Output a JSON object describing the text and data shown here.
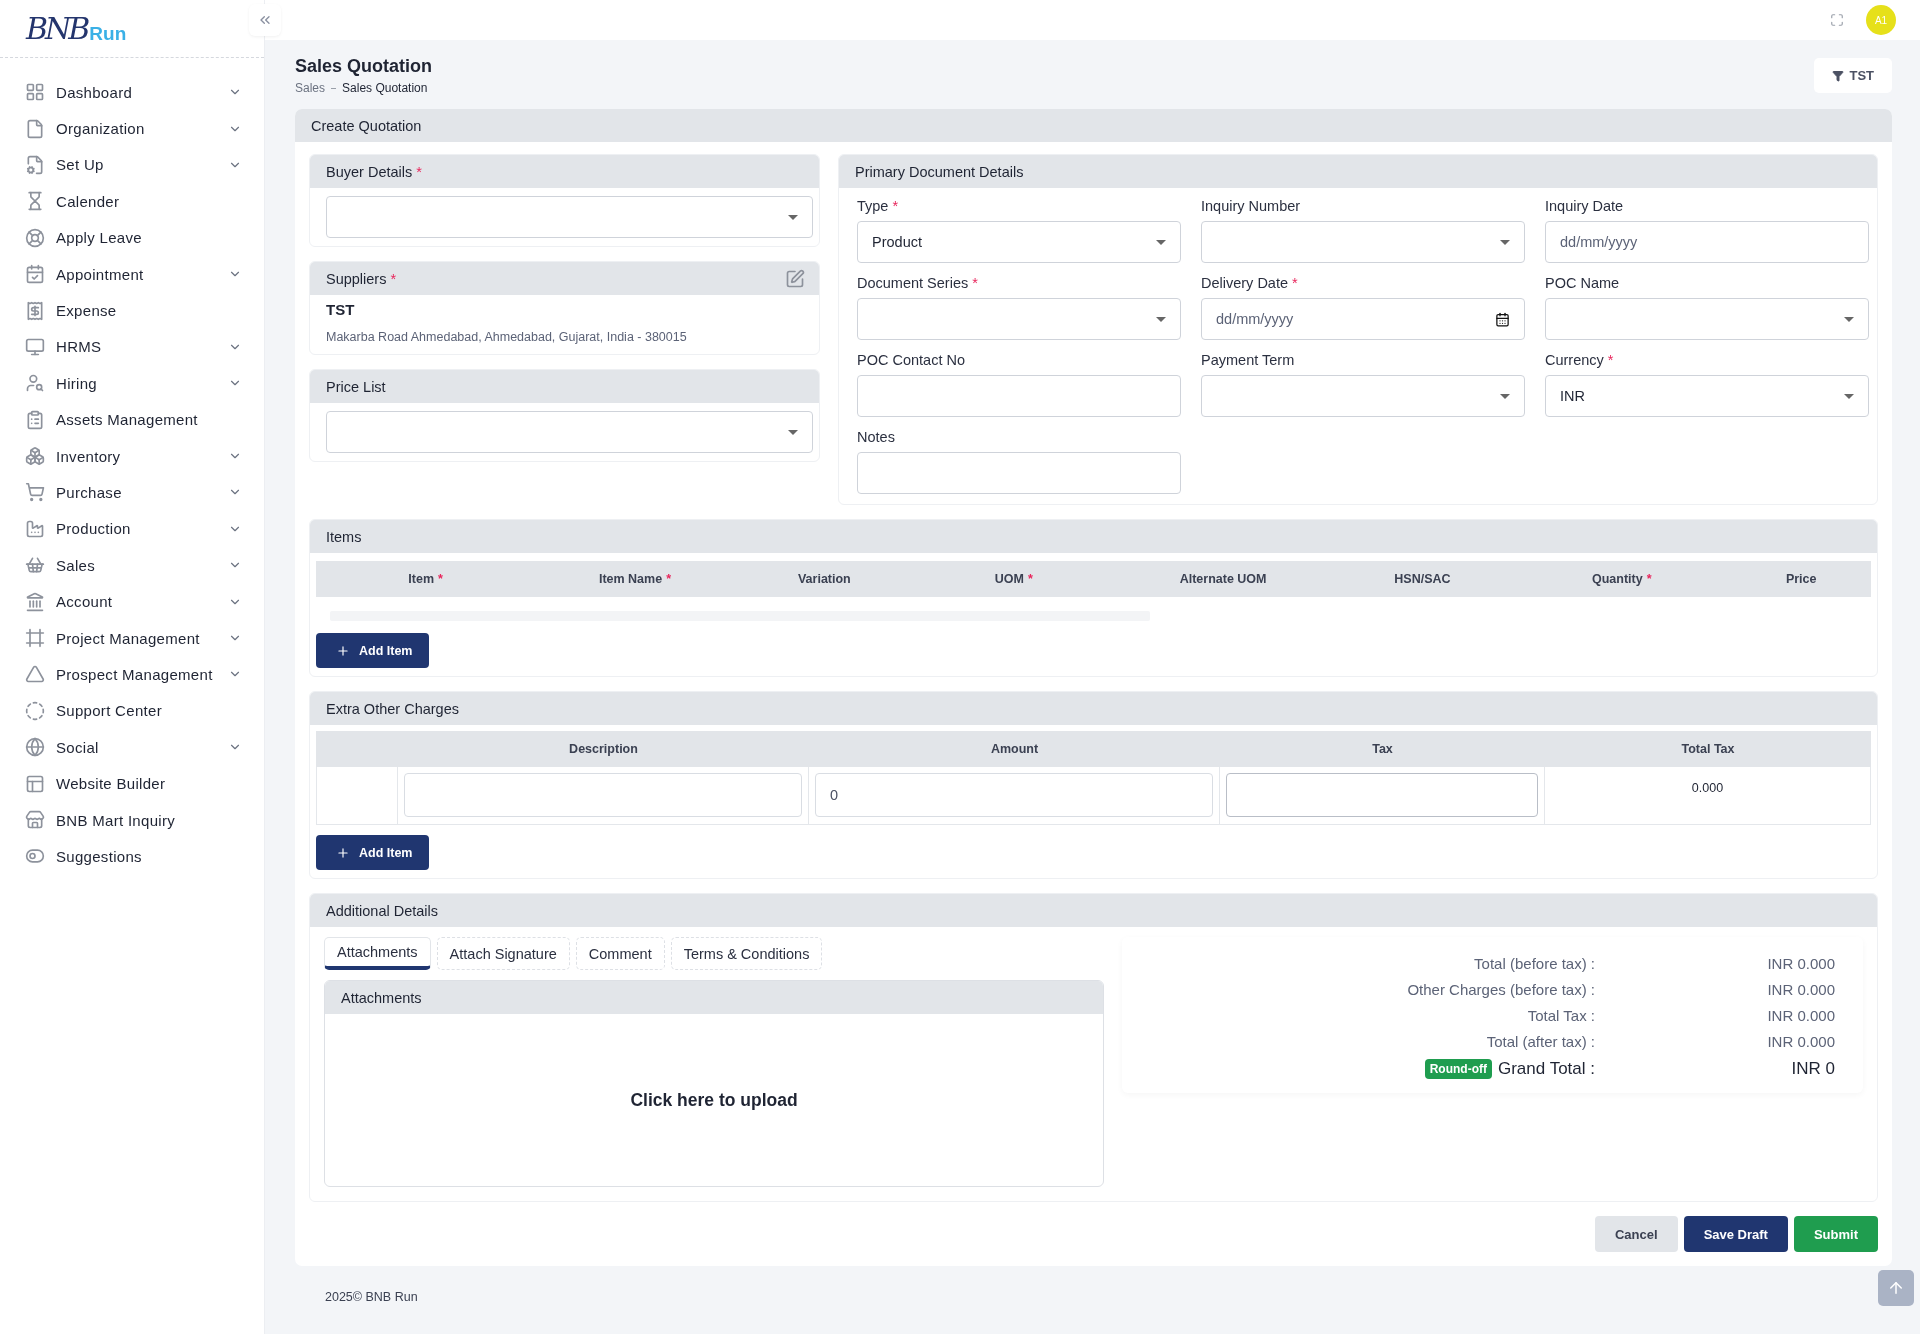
{
  "logo": {
    "mark": "BNB",
    "word": "Run"
  },
  "sidebar": {
    "items": [
      {
        "label": "Dashboard",
        "expandable": true
      },
      {
        "label": "Organization",
        "expandable": true
      },
      {
        "label": "Set Up",
        "expandable": true
      },
      {
        "label": "Calender",
        "expandable": false
      },
      {
        "label": "Apply Leave",
        "expandable": false
      },
      {
        "label": "Appointment",
        "expandable": true
      },
      {
        "label": "Expense",
        "expandable": false
      },
      {
        "label": "HRMS",
        "expandable": true
      },
      {
        "label": "Hiring",
        "expandable": true
      },
      {
        "label": "Assets Management",
        "expandable": false
      },
      {
        "label": "Inventory",
        "expandable": true
      },
      {
        "label": "Purchase",
        "expandable": true
      },
      {
        "label": "Production",
        "expandable": true
      },
      {
        "label": "Sales",
        "expandable": true
      },
      {
        "label": "Account",
        "expandable": true
      },
      {
        "label": "Project Management",
        "expandable": true
      },
      {
        "label": "Prospect Management",
        "expandable": true
      },
      {
        "label": "Support Center",
        "expandable": false
      },
      {
        "label": "Social",
        "expandable": true
      },
      {
        "label": "Website Builder",
        "expandable": false
      },
      {
        "label": "BNB Mart Inquiry",
        "expandable": false
      },
      {
        "label": "Suggestions",
        "expandable": false
      }
    ]
  },
  "topbar": {
    "avatar": "A1"
  },
  "page": {
    "title": "Sales Quotation",
    "breadcrumb": [
      "Sales",
      "Sales Quotation"
    ],
    "filter_button": "TST"
  },
  "form": {
    "title": "Create Quotation",
    "buyer": {
      "title": "Buyer Details",
      "required_mark": "*"
    },
    "suppliers": {
      "title": "Suppliers",
      "required_mark": "*",
      "name": "TST",
      "address": "Makarba Road Ahmedabad, Ahmedabad, Gujarat, India - 380015"
    },
    "price_list": {
      "title": "Price List"
    },
    "primary": {
      "title": "Primary Document Details",
      "fields": [
        {
          "label": "Type",
          "required_mark": "*",
          "kind": "select",
          "value": "Product"
        },
        {
          "label": "Inquiry Number",
          "kind": "select"
        },
        {
          "label": "Inquiry Date",
          "kind": "input",
          "placeholder": "dd/mm/yyyy"
        },
        {
          "label": "Document Series",
          "required_mark": "*",
          "kind": "select"
        },
        {
          "label": "Delivery Date",
          "required_mark": "*",
          "kind": "date",
          "placeholder": "dd/mm/yyyy"
        },
        {
          "label": "POC Name",
          "kind": "select"
        },
        {
          "label": "POC Contact No",
          "kind": "input"
        },
        {
          "label": "Payment Term",
          "kind": "select"
        },
        {
          "label": "Currency",
          "required_mark": "*",
          "kind": "select",
          "value": "INR"
        },
        {
          "label": "Notes",
          "kind": "input"
        }
      ]
    },
    "items": {
      "title": "Items",
      "columns": [
        {
          "label": "Item",
          "required_mark": "*"
        },
        {
          "label": "Item Name",
          "required_mark": "*"
        },
        {
          "label": "Variation"
        },
        {
          "label": "UOM",
          "required_mark": "*"
        },
        {
          "label": "Alternate UOM"
        },
        {
          "label": "HSN/SAC"
        },
        {
          "label": "Quantity",
          "required_mark": "*"
        },
        {
          "label": "Price"
        }
      ],
      "add_button": "Add Item"
    },
    "charges": {
      "title": "Extra Other Charges",
      "columns": [
        "Description",
        "Amount",
        "Tax",
        "Total Tax"
      ],
      "rows": [
        {
          "amount": "0",
          "total_tax": "0.000"
        }
      ],
      "add_button": "Add Item"
    },
    "additional": {
      "title": "Additional Details",
      "tabs": [
        {
          "label": "Attachments",
          "selected": true
        },
        {
          "label": "Attach Signature",
          "selected": false
        },
        {
          "label": "Comment",
          "selected": false
        },
        {
          "label": "Terms & Conditions",
          "selected": false
        }
      ],
      "panel_title": "Attachments",
      "upload": "Click here to upload",
      "summary": [
        {
          "label": "Total (before tax) :",
          "value": "INR 0.000",
          "kind": "plain"
        },
        {
          "label": "Other Charges (before tax) :",
          "value": "INR 0.000",
          "kind": "plain"
        },
        {
          "label": "Total Tax :",
          "value": "INR 0.000",
          "kind": "plain"
        },
        {
          "label": "Total (after tax) :",
          "value": "INR 0.000",
          "kind": "plain"
        },
        {
          "label": "Grand Total :",
          "value": "INR 0",
          "kind": "grand",
          "badge": "Round-off"
        }
      ]
    },
    "actions": [
      {
        "label": "Cancel",
        "kind": "secondary"
      },
      {
        "label": "Save Draft",
        "kind": "primary"
      },
      {
        "label": "Submit",
        "kind": "success"
      }
    ]
  },
  "footer": "2025© BNB Run"
}
